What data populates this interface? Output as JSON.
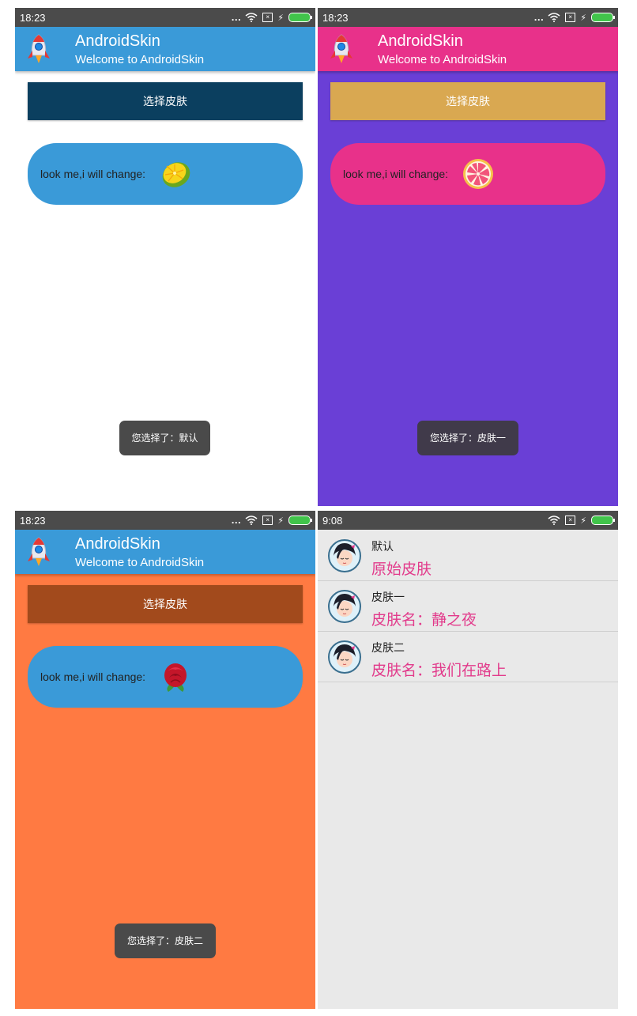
{
  "screens": [
    {
      "status_time": "18:23",
      "app_title": "AndroidSkin",
      "app_subtitle": "Welcome to AndroidSkin",
      "button_label": "选择皮肤",
      "pill_text": "look me,i will change:",
      "pill_icon": "lime-icon",
      "toast_text": "您选择了：默认",
      "colors": {
        "background": "#ffffff",
        "appbar": "#3a9ad8",
        "button": "#0b3f5f",
        "pill": "#3a9ad8",
        "toast": "#4a4a4a"
      }
    },
    {
      "status_time": "18:23",
      "app_title": "AndroidSkin",
      "app_subtitle": "Welcome to AndroidSkin",
      "button_label": "选择皮肤",
      "pill_text": "look me,i will change:",
      "pill_icon": "grapefruit-icon",
      "toast_text": "您选择了：皮肤一",
      "colors": {
        "background": "#6a3fd6",
        "appbar": "#e8318a",
        "button": "#d9a851",
        "pill": "#e8318a",
        "toast": "#403a4a"
      }
    },
    {
      "status_time": "18:23",
      "app_title": "AndroidSkin",
      "app_subtitle": "Welcome to AndroidSkin",
      "button_label": "选择皮肤",
      "pill_text": "look me,i will change:",
      "pill_icon": "rose-icon",
      "toast_text": "您选择了：皮肤二",
      "colors": {
        "background": "#ff7a42",
        "appbar": "#3a9ad8",
        "button": "#a24a1c",
        "pill": "#3a9ad8",
        "toast": "#4a4a4a"
      }
    }
  ],
  "skin_list": {
    "status_time": "9:08",
    "items": [
      {
        "title": "默认",
        "subtitle": "原始皮肤"
      },
      {
        "title": "皮肤一",
        "subtitle": "皮肤名：静之夜"
      },
      {
        "title": "皮肤二",
        "subtitle": "皮肤名：我们在路上"
      }
    ],
    "colors": {
      "background": "#e9e9e9",
      "subtitle": "#e23a8b"
    }
  }
}
